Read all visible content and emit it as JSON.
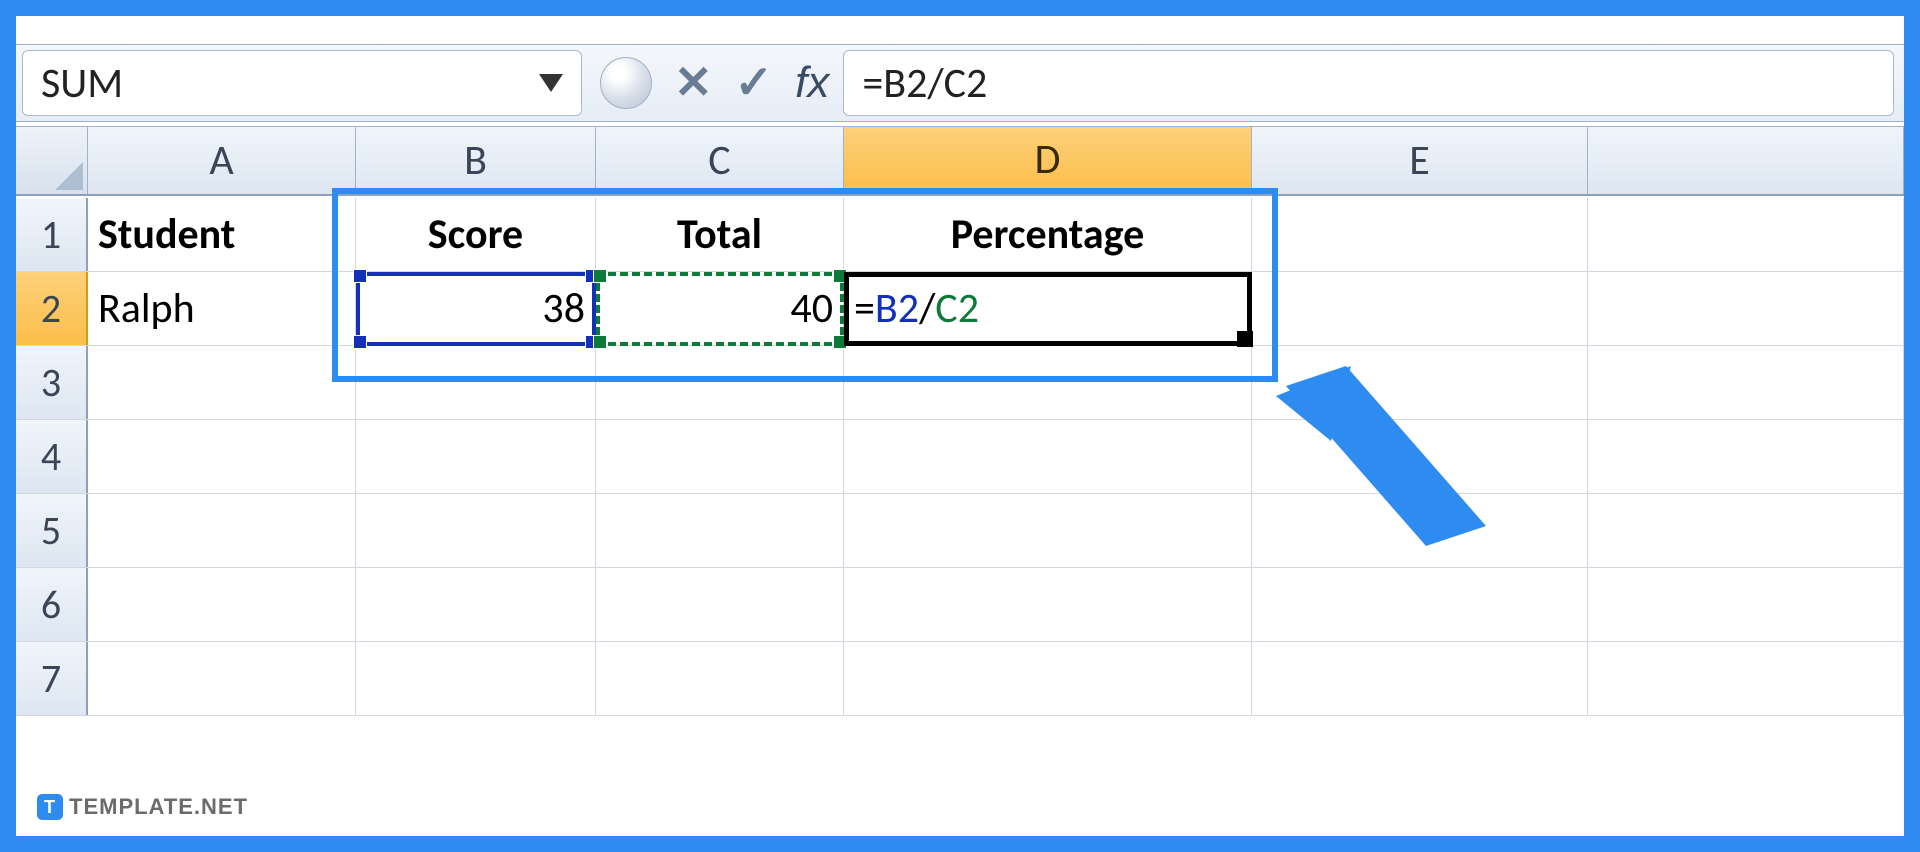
{
  "formula_bar": {
    "name_box": "SUM",
    "cancel_glyph": "✕",
    "enter_glyph": "✓",
    "fx_label": "fx",
    "formula_plain": "=B2/C2",
    "formula_parts": {
      "eq": "=",
      "b2": "B2",
      "slash": "/",
      "c2": "C2"
    }
  },
  "columns": {
    "A": "A",
    "B": "B",
    "C": "C",
    "D": "D",
    "E": "E"
  },
  "rows": [
    "1",
    "2",
    "3",
    "4",
    "5",
    "6",
    "7"
  ],
  "cells": {
    "A1": "Student",
    "B1": "Score",
    "C1": "Total",
    "D1": "Percentage",
    "A2": "Ralph",
    "B2": "38",
    "C2": "40",
    "D2_parts": {
      "eq": "=",
      "b2": "B2",
      "slash": "/",
      "c2": "C2"
    }
  },
  "watermark": {
    "badge": "T",
    "text": "TEMPLATE.NET"
  }
}
